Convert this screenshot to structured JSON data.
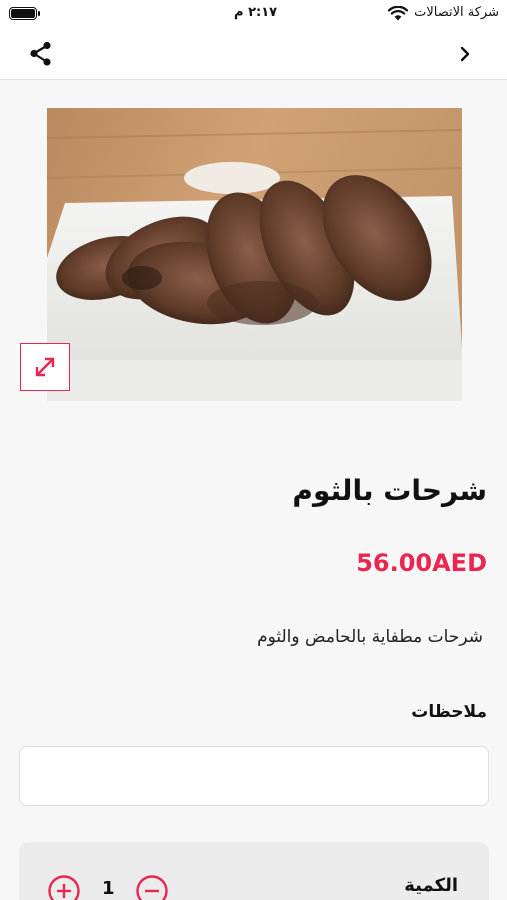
{
  "status_bar": {
    "time": "٢:١٧ م",
    "carrier": "شركة الاتصالات",
    "icons": [
      "battery-icon",
      "wifi-icon"
    ]
  },
  "nav": {
    "icons": [
      "share-icon",
      "back-chevron-icon"
    ]
  },
  "product": {
    "image_description_icon": "expand-icon",
    "title": "شرحات بالثوم",
    "price": "56.00AED",
    "description": "شرحات مطفاية بالحامض والثوم"
  },
  "notes": {
    "label": "ملاحظات",
    "value": "",
    "placeholder": ""
  },
  "quantity": {
    "label": "الكمية",
    "value": "1",
    "icons": [
      "plus-circle-icon",
      "minus-circle-icon"
    ]
  },
  "colors": {
    "accent": "#e8264f",
    "background": "#f7f7f7",
    "panel": "#ececec"
  }
}
